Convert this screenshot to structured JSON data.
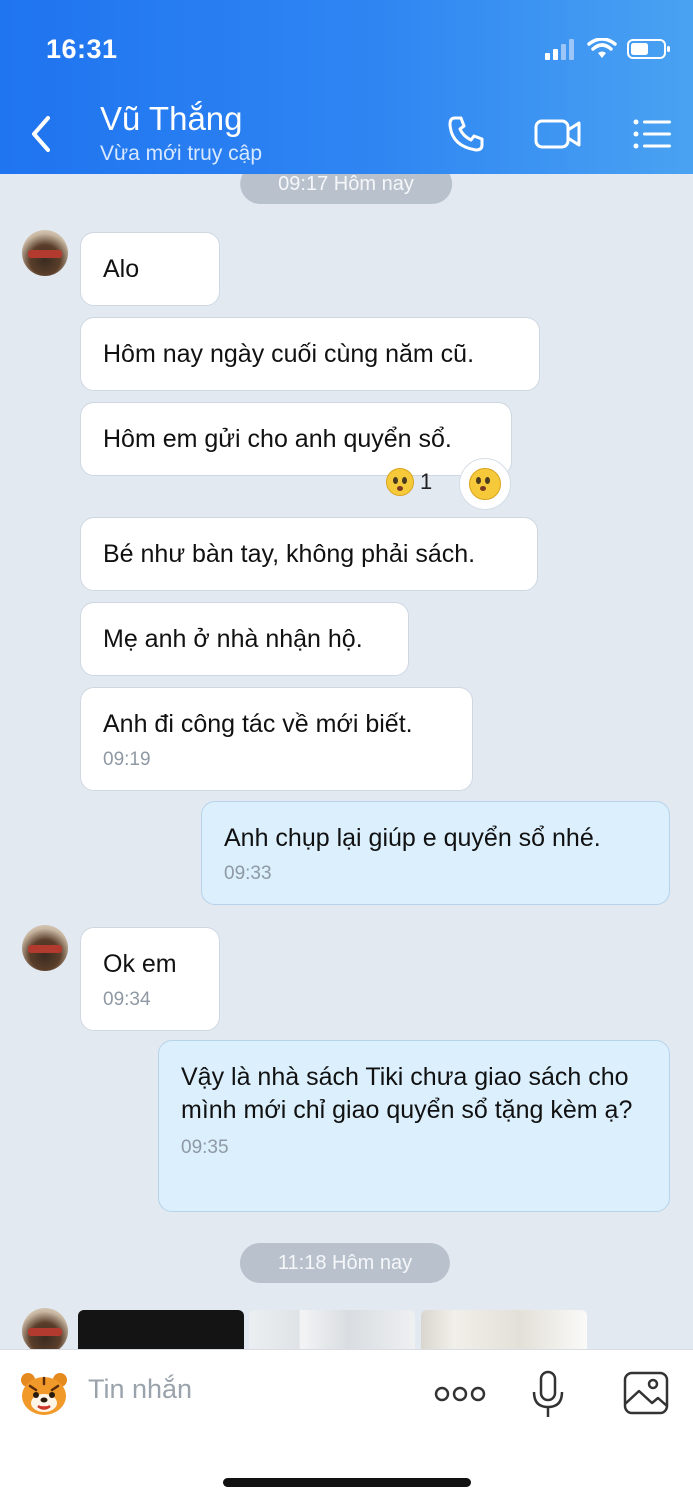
{
  "status_bar": {
    "time": "16:31"
  },
  "header": {
    "contact_name": "Vũ Thắng",
    "contact_status": "Vừa mới truy cập",
    "back_icon": "chevron-left-icon",
    "call_icon": "phone-icon",
    "video_icon": "video-camera-icon",
    "menu_icon": "list-menu-icon",
    "gradient_colors": [
      "#1f74f0",
      "#4aa2f2"
    ]
  },
  "chat": {
    "separators": [
      "09:17 Hôm nay",
      "11:18 Hôm nay"
    ],
    "messages": [
      {
        "text": "Alo"
      },
      {
        "text": "Hôm nay ngày cuối cùng năm cũ."
      },
      {
        "text": "Hôm em gửi cho anh quyển sổ.",
        "reaction_count": "1"
      },
      {
        "text": "Bé như bàn tay, không phải sách."
      },
      {
        "text": "Mẹ anh ở nhà nhận hộ."
      },
      {
        "text": "Anh đi công tác về mới biết.",
        "time": "09:19"
      },
      {
        "text": "Anh chụp lại giúp e quyển sổ nhé.",
        "time": "09:33"
      },
      {
        "text": "Ok em",
        "time": "09:34"
      },
      {
        "text": "Vậy là nhà sách Tiki chưa giao sách cho mình mới chỉ giao quyển sổ tặng kèm ạ?",
        "time": "09:35"
      }
    ],
    "outgoing_bubble_color": "#dbeffd",
    "incoming_bubble_color": "#ffffff"
  },
  "composer": {
    "placeholder": "Tin nhắn",
    "sticker_icon": "tiger-sticker-icon",
    "more_icon": "more-dots-icon",
    "mic_icon": "microphone-icon",
    "image_icon": "image-icon"
  }
}
